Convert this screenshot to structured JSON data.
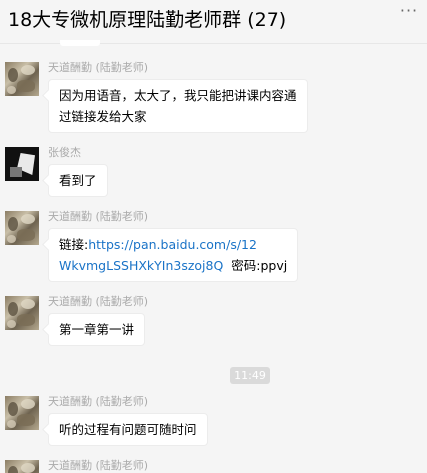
{
  "header": {
    "title": "18大专微机原理陆勤老师群 (27)",
    "more_icon": "more-icon"
  },
  "messages": [
    {
      "sender": "天道酬勤 (陆勤老师)",
      "lines": [
        "因为用语音，太大了，我只能把讲课内容通",
        "过链接发给大家"
      ]
    },
    {
      "sender": "张俊杰",
      "lines": [
        "看到了"
      ]
    },
    {
      "sender": "天道酬勤 (陆勤老师)",
      "label": "链接:",
      "link_line1": "https://pan.baidu.com/s/12",
      "link_line2": "WkvmgLSSHXkYIn3szoj8Q",
      "code": "密码:ppvj"
    },
    {
      "sender": "天道酬勤 (陆勤老师)",
      "lines": [
        "第一章第一讲"
      ]
    },
    {
      "sender": "天道酬勤 (陆勤老师)",
      "lines": [
        "听的过程有问题可随时问"
      ]
    },
    {
      "sender": "天道酬勤 (陆勤老师)"
    }
  ],
  "time_separator": "11:49",
  "colors": {
    "link": "#1a73c7",
    "sender": "#aaaaaa",
    "background": "#f5f5f5"
  }
}
